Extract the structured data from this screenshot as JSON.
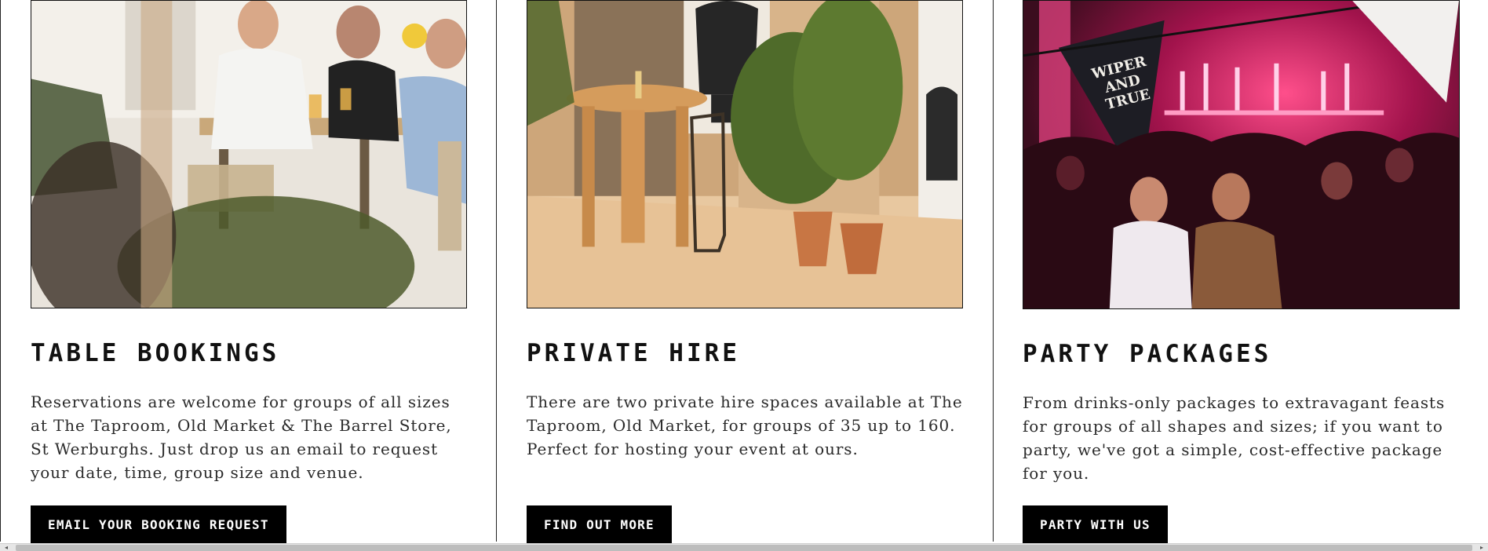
{
  "cards": [
    {
      "title": "TABLE BOOKINGS",
      "body": "Reservations are welcome for groups of all sizes at The Taproom, Old Market & The Barrel Store, St Werburghs. Just drop us an email to request your date, time, group size and venue.",
      "cta_label": "EMAIL YOUR BOOKING REQUEST",
      "image_icon": "photo-people-at-table"
    },
    {
      "title": "PRIVATE HIRE",
      "body": "There are two private hire spaces available at The Taproom, Old Market, for groups of 35 up to 160. Perfect for hosting your event at ours.",
      "cta_label": "FIND OUT MORE",
      "image_icon": "photo-table-and-plants"
    },
    {
      "title": "PARTY PACKAGES",
      "body": "From drinks-only packages to extravagant feasts for groups of all shapes and sizes; if you want to party, we've got a simple, cost-effective package for you.",
      "cta_label": "PARTY WITH US",
      "image_icon": "photo-party-crowd",
      "banner_text": [
        "WIPER",
        "AND",
        "TRUE"
      ]
    }
  ],
  "scrollbar": {
    "left_arrow": "◂",
    "right_arrow": "▸"
  },
  "colors": {
    "button_bg": "#000000",
    "button_text": "#ffffff",
    "rule": "#222222"
  }
}
